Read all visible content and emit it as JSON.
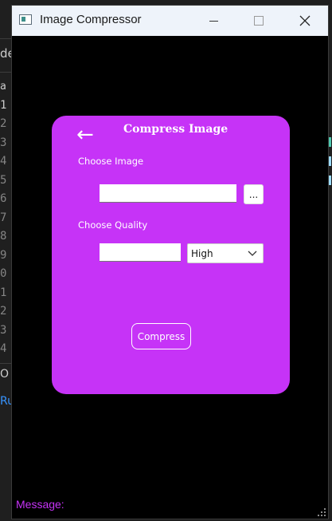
{
  "background": {
    "tab_fragment": "de",
    "line_numbers": [
      "a",
      "1",
      "2",
      "3",
      "4",
      "5",
      "6",
      "7",
      "8",
      "9",
      "0",
      "1",
      "2",
      "3",
      "4"
    ],
    "panel_fragment_1": "O",
    "panel_fragment_2": "Ru"
  },
  "window": {
    "title": "Image Compressor",
    "icon": "app-window-icon",
    "controls": {
      "minimize": "minimize-icon",
      "maximize": "maximize-icon",
      "close": "close-icon"
    }
  },
  "card": {
    "back_icon": "←",
    "title": "Compress Image",
    "choose_image_label": "Choose Image",
    "image_path_value": "",
    "browse_label": "...",
    "choose_quality_label": "Choose Quality",
    "quality_value_input": "",
    "quality_selected": "High",
    "compress_label": "Compress"
  },
  "status": {
    "message_label": "Message:"
  },
  "colors": {
    "card_bg": "#c633f7",
    "window_bg": "#000000",
    "message_text": "#c633f7",
    "titlebar_bg": "#eef3fa"
  }
}
